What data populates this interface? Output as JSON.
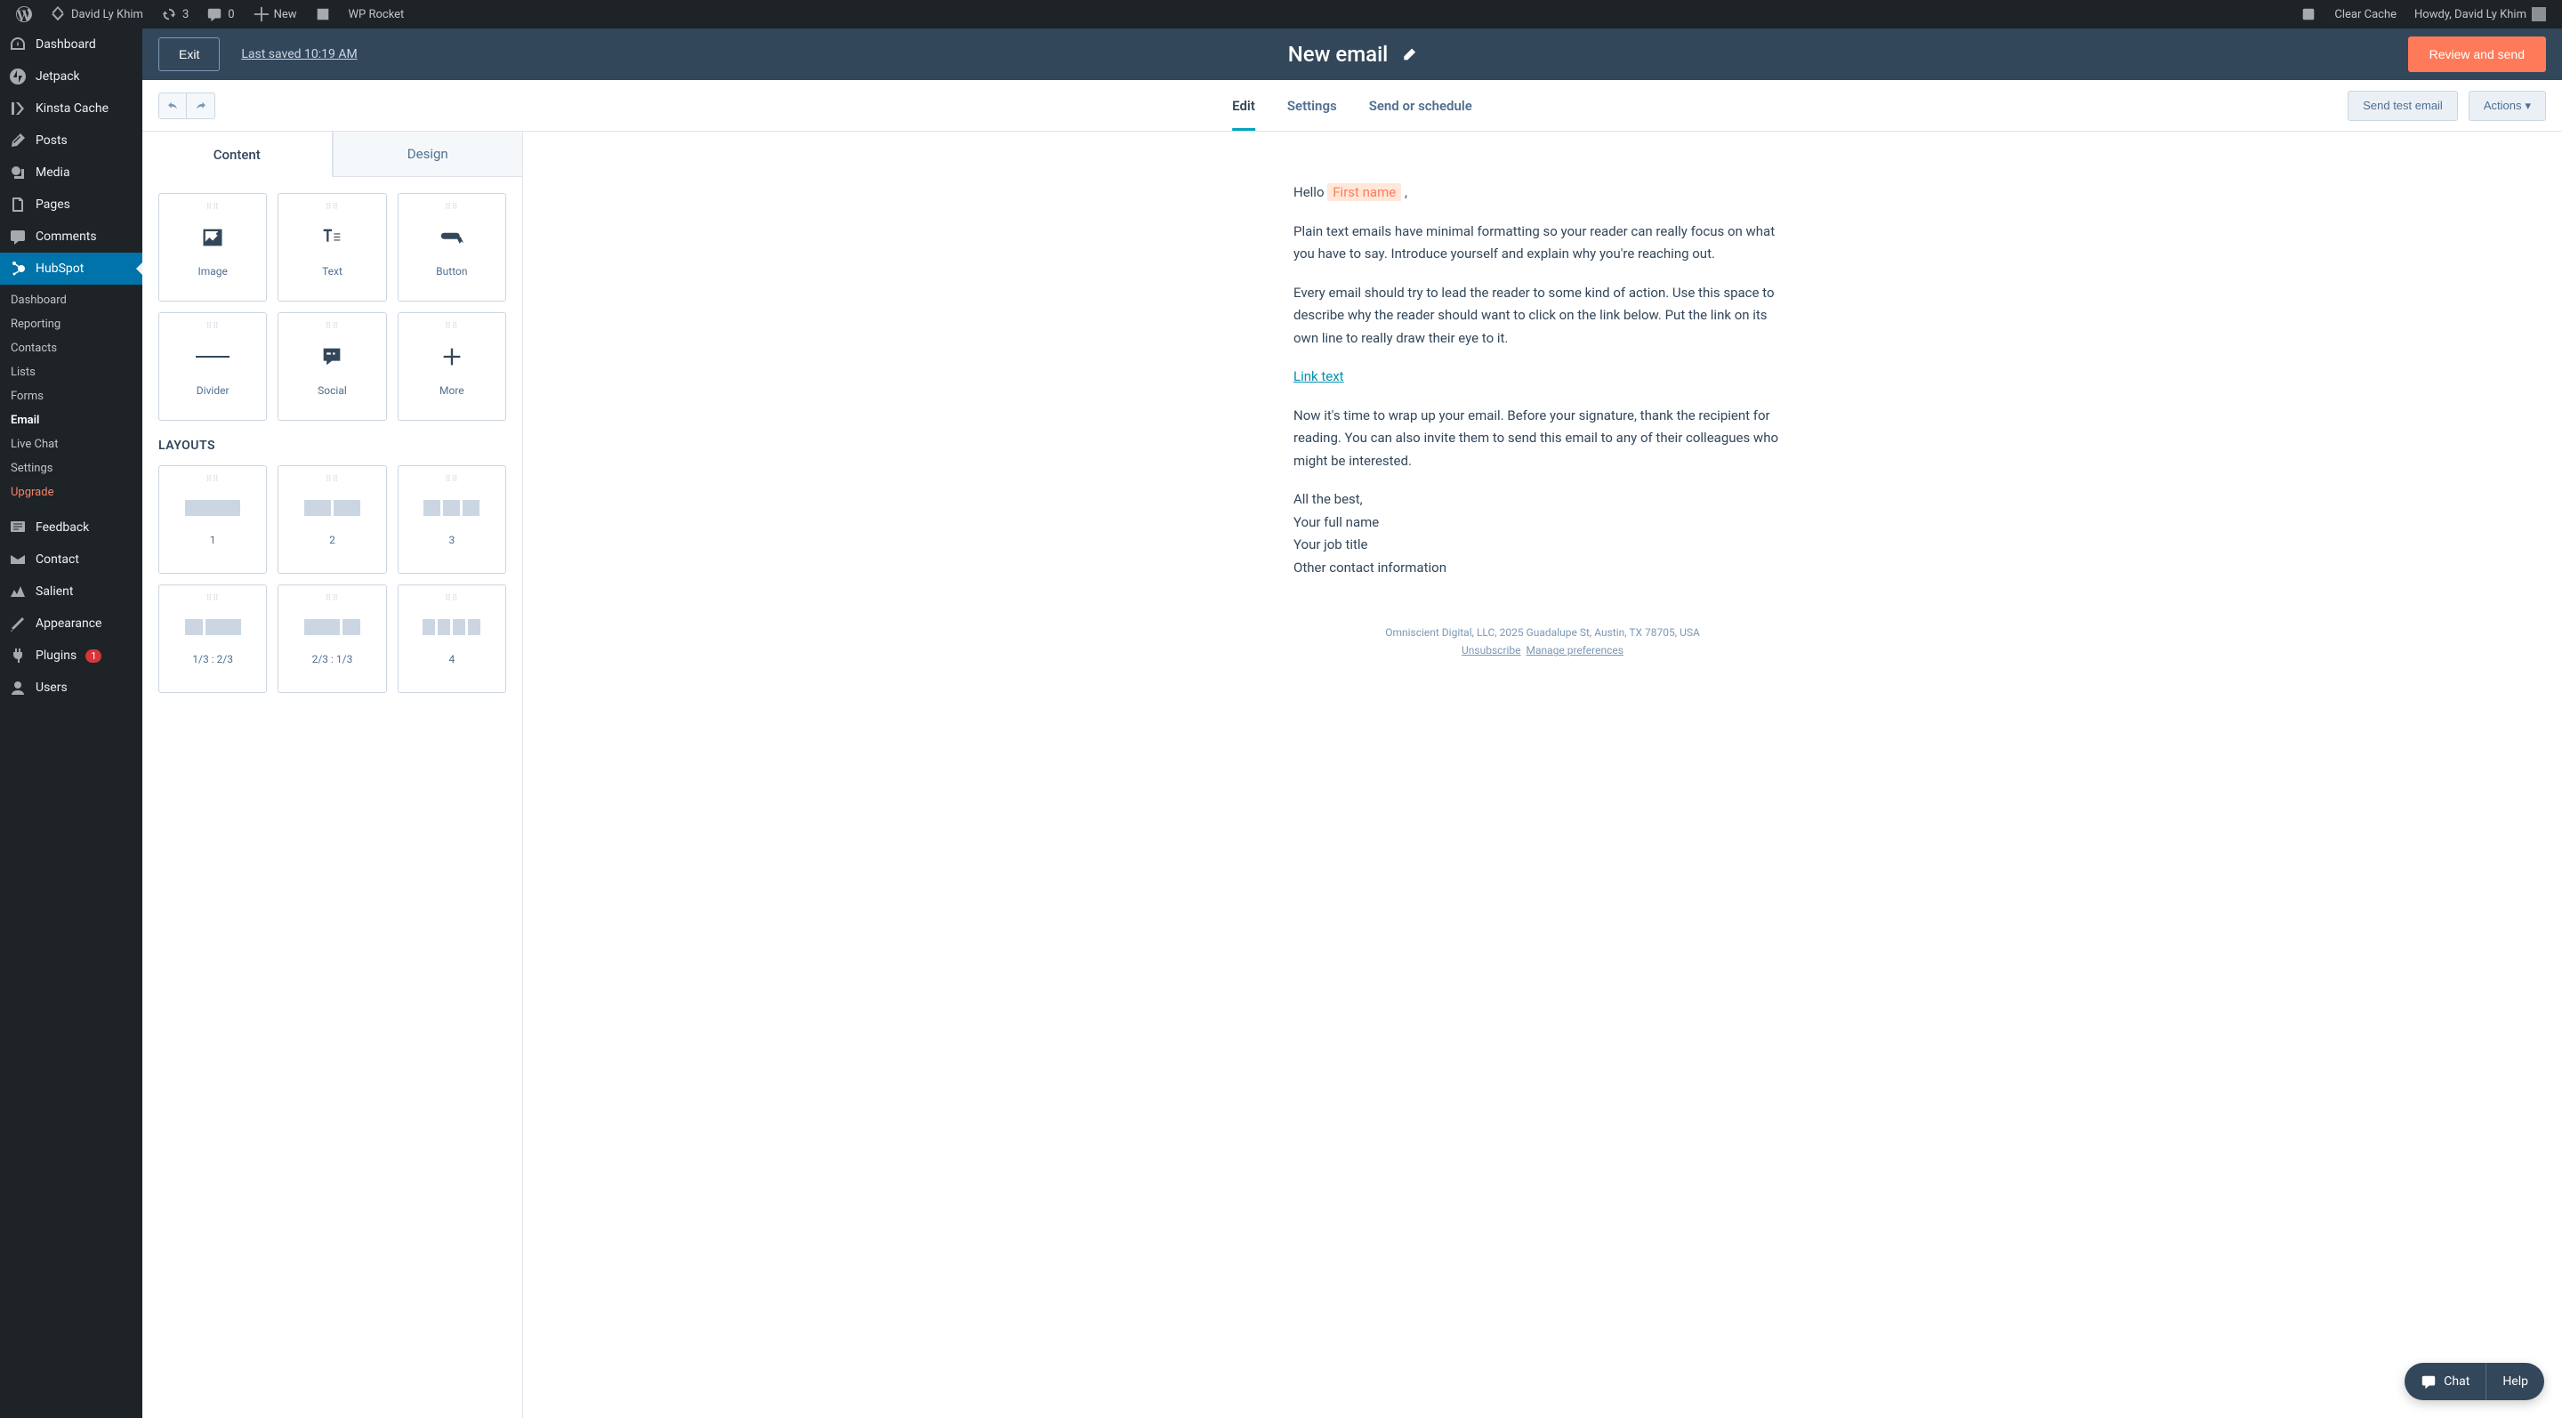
{
  "adminBar": {
    "siteName": "David Ly Khim",
    "updates": "3",
    "comments": "0",
    "new": "New",
    "wpRocket": "WP Rocket",
    "clearCache": "Clear Cache",
    "howdy": "Howdy, David Ly Khim"
  },
  "wpMenu": {
    "dashboard": "Dashboard",
    "jetpack": "Jetpack",
    "kinsta": "Kinsta Cache",
    "posts": "Posts",
    "media": "Media",
    "pages": "Pages",
    "comments": "Comments",
    "hubspot": "HubSpot",
    "feedback": "Feedback",
    "contact": "Contact",
    "salient": "Salient",
    "appearance": "Appearance",
    "plugins": "Plugins",
    "pluginsBadge": "1",
    "users": "Users"
  },
  "hubspotSubmenu": {
    "dashboard": "Dashboard",
    "reporting": "Reporting",
    "contacts": "Contacts",
    "lists": "Lists",
    "forms": "Forms",
    "email": "Email",
    "liveChat": "Live Chat",
    "settings": "Settings",
    "upgrade": "Upgrade"
  },
  "hsHeader": {
    "exit": "Exit",
    "lastSaved": "Last saved 10:19 AM",
    "title": "New email",
    "review": "Review and send"
  },
  "hsSubheader": {
    "tabs": {
      "edit": "Edit",
      "settings": "Settings",
      "send": "Send or schedule"
    },
    "sendTest": "Send test email",
    "actions": "Actions"
  },
  "panel": {
    "tabs": {
      "content": "Content",
      "design": "Design"
    },
    "blocks": {
      "image": "Image",
      "text": "Text",
      "button": "Button",
      "divider": "Divider",
      "social": "Social",
      "more": "More"
    },
    "layoutsHeading": "LAYOUTS",
    "layouts": {
      "l1": "1",
      "l2": "2",
      "l3": "3",
      "l13_23": "1/3 : 2/3",
      "l23_13": "2/3 : 1/3",
      "l4": "4"
    }
  },
  "email": {
    "hello": "Hello",
    "token": "First name",
    "comma": ",",
    "p1": "Plain text emails have minimal formatting so your reader can really focus on what you have to say. Introduce yourself and explain why you're reaching out.",
    "p2": "Every email should try to lead the reader to some kind of action. Use this space to describe why the reader should want to click on the link below. Put the link on its own line to really draw their eye to it.",
    "link": "Link text",
    "p3": "Now it's time to wrap up your email. Before your signature, thank the recipient for reading. You can also invite them to send this email to any of their colleagues who might be interested.",
    "closing": "All the best,",
    "name": "Your full name",
    "title": "Your job title",
    "other": "Other contact information",
    "footerCompany": "Omniscient Digital, LLC, 2025 Guadalupe St, Austin, TX 78705, USA",
    "unsubscribe": "Unsubscribe",
    "managePrefs": "Manage preferences"
  },
  "chat": {
    "chat": "Chat",
    "help": "Help"
  }
}
